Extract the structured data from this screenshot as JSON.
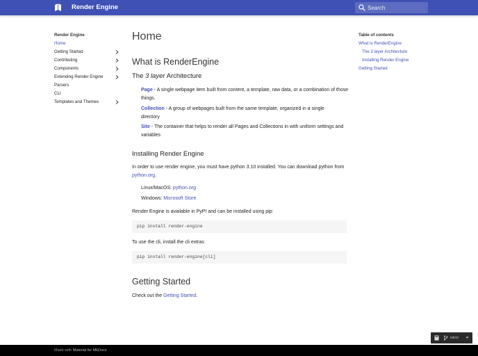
{
  "header": {
    "site_title": "Render Engine",
    "search_placeholder": "Search",
    "brand_color": "#4051b5"
  },
  "nav": {
    "title": "Render Engine",
    "items": [
      {
        "label": "Home",
        "active": true,
        "expandable": false
      },
      {
        "label": "Getting Started",
        "active": false,
        "expandable": true
      },
      {
        "label": "Contributing",
        "active": false,
        "expandable": true
      },
      {
        "label": "Components",
        "active": false,
        "expandable": true
      },
      {
        "label": "Extending Render Engine",
        "active": false,
        "expandable": true
      },
      {
        "label": "Parsers",
        "active": false,
        "expandable": false
      },
      {
        "label": "CLI",
        "active": false,
        "expandable": false
      },
      {
        "label": "Templates and Themes",
        "active": false,
        "expandable": true
      }
    ]
  },
  "main": {
    "title": "Home",
    "section_title": "What is RenderEngine",
    "arch_prefix": "The ",
    "arch_em": "3 layer",
    "arch_suffix": " Architecture",
    "layers": [
      {
        "term": "Page",
        "text": " - A single webpage item built from content, a template, raw data, or a combination of those things."
      },
      {
        "term": "Collection",
        "text": " - A group of webpages built from the same template, organized in a single directory"
      },
      {
        "term": "Site",
        "text": " - The container that helps to render all Pages and Collections in with uniform settings and variables"
      }
    ],
    "install_title": "Installing Render Engine",
    "install_text_before": "In order to use render engine, you must have python 3.10 installed. You can download python from ",
    "install_link": "python.org",
    "install_text_after": ".",
    "downloads": [
      {
        "label": "Linux/MacOS: ",
        "link": "python.org"
      },
      {
        "label": "Windows: ",
        "link": "Microsoft Store"
      }
    ],
    "pypi_text": "Render Engine is available in PyPI and can be installed using pip:",
    "code1": "pip install render-engine",
    "cli_text": "To use the cli, install the cli extras",
    "code2": "pip install render-engine[cli]",
    "getting_started_title": "Getting Started",
    "check_prefix": "Check out the ",
    "check_link": "Getting Started",
    "check_suffix": "."
  },
  "toc": {
    "title": "Table of contents",
    "items": [
      {
        "label": "What is RenderEngine",
        "level": 1
      },
      {
        "label": "The 3 layer Architecture",
        "level": 2
      },
      {
        "label": "Installing Render Engine",
        "level": 2
      },
      {
        "label": "Getting Started",
        "level": 1
      }
    ]
  },
  "widget": {
    "version": "latest"
  },
  "footer": {
    "prefix": "Made with ",
    "link": "Material for MkDocs"
  }
}
